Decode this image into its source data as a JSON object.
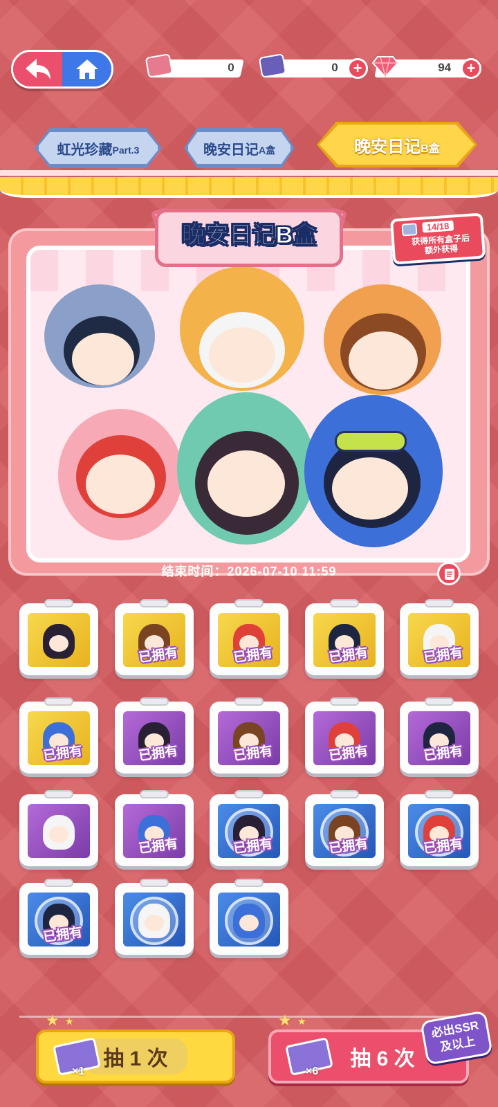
{
  "topbar": {
    "currencies": [
      {
        "icon": "pink-ticket-icon",
        "value": "0"
      },
      {
        "icon": "purple-ticket-icon",
        "value": "0"
      },
      {
        "icon": "gem-icon",
        "value": "94"
      }
    ]
  },
  "tabs": [
    {
      "main": "虹光珍藏",
      "sub": "Part.3",
      "active": false
    },
    {
      "main": "晚安日记",
      "sub": "A盒",
      "active": false
    },
    {
      "main": "晚安日记",
      "sub": "B盒",
      "active": true
    }
  ],
  "banner": {
    "title": "晚安日记B盒",
    "progress": "14/18",
    "bonus_note_line1": "获得所有盒子后",
    "bonus_note_line2": "额外获得",
    "end_time": "结束时间：2026-07-10 11:59"
  },
  "owned_label": "已拥有",
  "items": [
    {
      "tier": "yellow",
      "owned": false,
      "kind": "card"
    },
    {
      "tier": "yellow",
      "owned": true,
      "kind": "card"
    },
    {
      "tier": "yellow",
      "owned": true,
      "kind": "card"
    },
    {
      "tier": "yellow",
      "owned": true,
      "kind": "card"
    },
    {
      "tier": "yellow",
      "owned": true,
      "kind": "card"
    },
    {
      "tier": "yellow",
      "owned": true,
      "kind": "card"
    },
    {
      "tier": "purple",
      "owned": true,
      "kind": "card"
    },
    {
      "tier": "purple",
      "owned": true,
      "kind": "card"
    },
    {
      "tier": "purple",
      "owned": true,
      "kind": "card"
    },
    {
      "tier": "purple",
      "owned": true,
      "kind": "card"
    },
    {
      "tier": "purple",
      "owned": false,
      "kind": "card"
    },
    {
      "tier": "purple",
      "owned": true,
      "kind": "card"
    },
    {
      "tier": "blue",
      "owned": true,
      "kind": "badge"
    },
    {
      "tier": "blue",
      "owned": true,
      "kind": "badge"
    },
    {
      "tier": "blue",
      "owned": true,
      "kind": "badge"
    },
    {
      "tier": "blue",
      "owned": true,
      "kind": "badge"
    },
    {
      "tier": "blue",
      "owned": false,
      "kind": "badge"
    },
    {
      "tier": "blue",
      "owned": false,
      "kind": "badge"
    }
  ],
  "actions": {
    "single": {
      "label": "抽 1 次",
      "count": "×1"
    },
    "multi": {
      "label": "抽 6 次",
      "count": "×6"
    },
    "guarantee_line1": "必出SSR",
    "guarantee_line2": "及以上"
  },
  "colors": {
    "accent_pink": "#ec4f6c",
    "accent_yellow": "#ffd93f",
    "owned_outline": "#9b4fb8",
    "bg": "#d65e62"
  }
}
